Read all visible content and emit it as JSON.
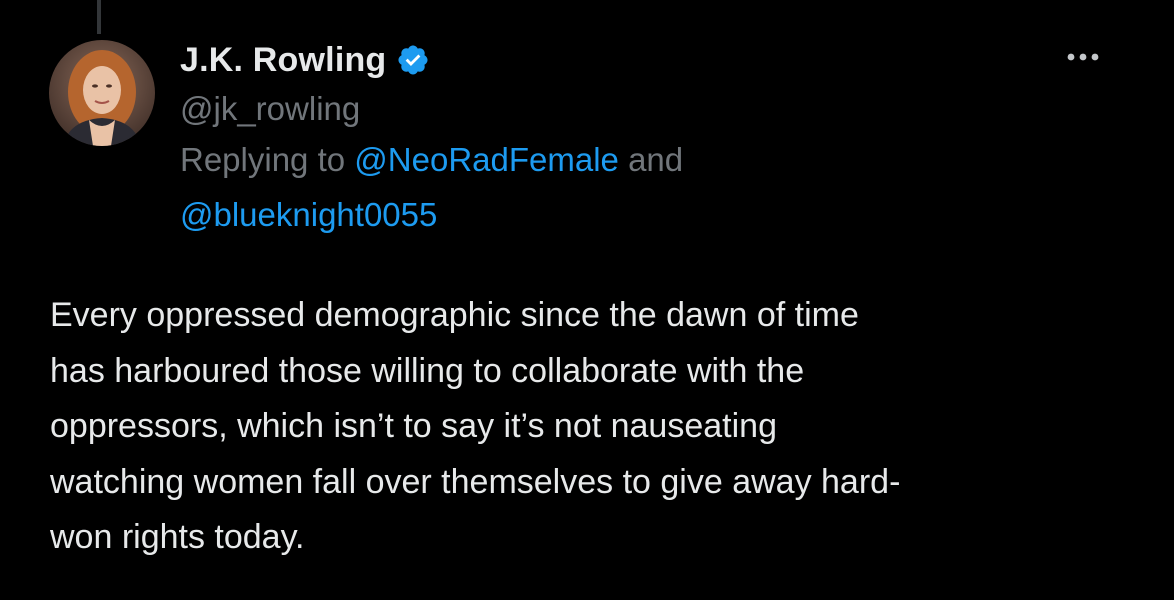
{
  "tweet": {
    "author": {
      "display_name": "J.K. Rowling",
      "handle": "@jk_rowling",
      "verified": true
    },
    "reply_context": {
      "prefix": "Replying to",
      "mention_1": "@NeoRadFemale",
      "conjunction": "and",
      "mention_2": "@blueknight0055"
    },
    "body_lines": [
      "Every oppressed demographic since the dawn of time",
      "has harboured those willing to collaborate with the",
      "oppressors, which isn’t to say it’s not nauseating",
      "watching women fall over themselves to give away hard-",
      "won rights today."
    ]
  },
  "icons": {
    "verified": "verified-badge-icon",
    "more": "more-options-icon"
  },
  "colors": {
    "background": "#000000",
    "primary_text": "#e7e9ea",
    "secondary_text": "#71767b",
    "accent": "#1d9bf0"
  }
}
